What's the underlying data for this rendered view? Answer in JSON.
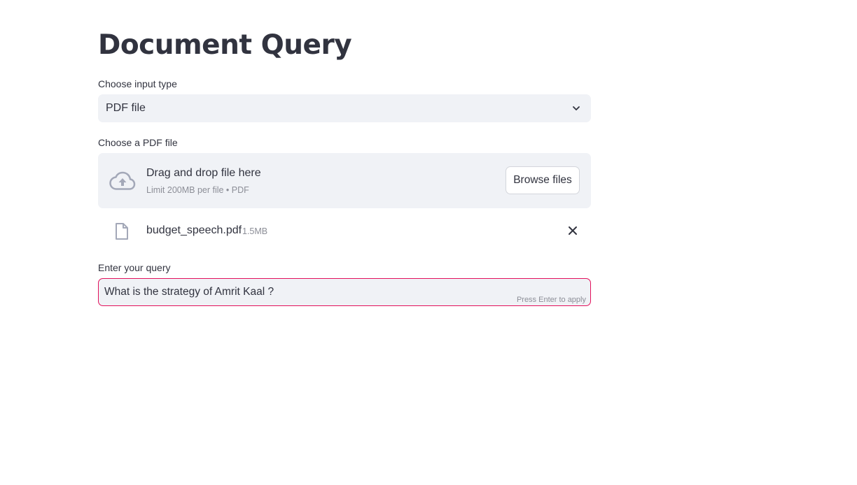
{
  "page": {
    "title": "Document Query"
  },
  "input_type": {
    "label": "Choose input type",
    "selected": "PDF file"
  },
  "uploader": {
    "label": "Choose a PDF file",
    "drag_text": "Drag and drop file here",
    "limit_text": "Limit 200MB per file • PDF",
    "browse_label": "Browse files",
    "file": {
      "name": "budget_speech.pdf",
      "size": "1.5MB"
    }
  },
  "query": {
    "label": "Enter your query",
    "value": "What is the strategy of Amrit Kaal ?",
    "hint": "Press Enter to apply"
  },
  "colors": {
    "background": "#ffffff",
    "panel": "#f0f2f6",
    "text": "#31333f",
    "muted": "#8c8e97",
    "focus_border": "#e3105b"
  },
  "icons": {
    "select_arrow": "chevron-down-icon",
    "upload": "cloud-upload-icon",
    "file": "file-icon",
    "remove": "close-icon"
  }
}
